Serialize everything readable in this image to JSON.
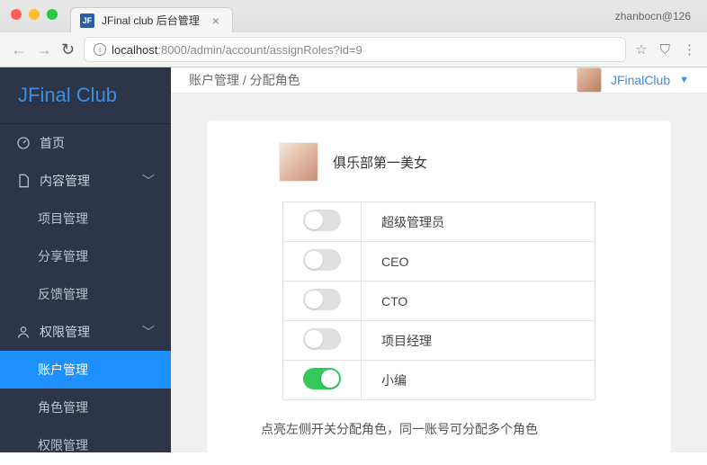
{
  "browser": {
    "tab_title": "JFinal club 后台管理",
    "favicon_text": "JF",
    "profile_text": "zhanbocn@126",
    "url_host": "localhost",
    "url_rest": ":8000/admin/account/assignRoles?id=9"
  },
  "sidebar": {
    "brand": "JFinal Club",
    "items": [
      {
        "label": "首页",
        "icon": "dashboard"
      },
      {
        "label": "内容管理",
        "icon": "doc",
        "children": [
          "项目管理",
          "分享管理",
          "反馈管理"
        ]
      },
      {
        "label": "权限管理",
        "icon": "user",
        "children": [
          "账户管理",
          "角色管理",
          "权限管理"
        ],
        "activeChild": "账户管理"
      }
    ]
  },
  "header": {
    "breadcrumb": "账户管理 / 分配角色",
    "user": "JFinalClub"
  },
  "profile": {
    "nickname": "俱乐部第一美女"
  },
  "roles": [
    {
      "name": "超级管理员",
      "on": false
    },
    {
      "name": "CEO",
      "on": false
    },
    {
      "name": "CTO",
      "on": false
    },
    {
      "name": "项目经理",
      "on": false
    },
    {
      "name": "小编",
      "on": true
    }
  ],
  "hint": "点亮左侧开关分配角色，同一账号可分配多个角色"
}
